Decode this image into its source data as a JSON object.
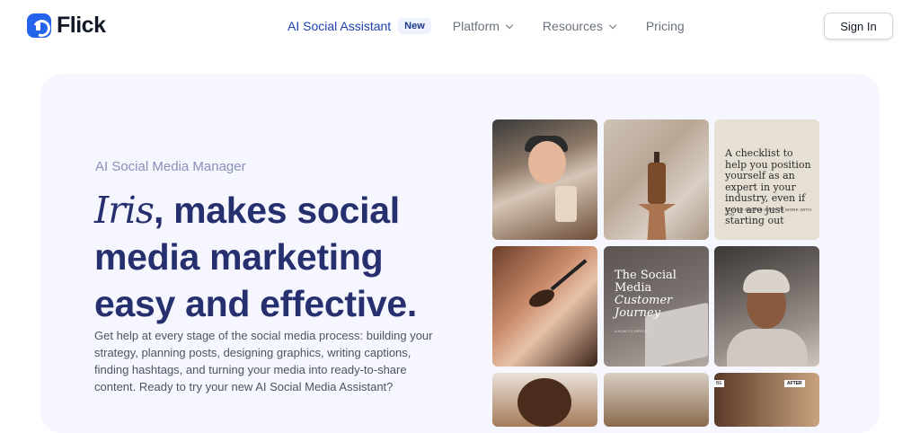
{
  "brand": {
    "name": "Flick",
    "color": "#2563eb"
  },
  "nav": {
    "items": [
      {
        "label": "AI Social Assistant",
        "badge": "New",
        "active": true
      },
      {
        "label": "Platform",
        "dropdown": true
      },
      {
        "label": "Resources",
        "dropdown": true
      },
      {
        "label": "Pricing"
      }
    ]
  },
  "header": {
    "signin_label": "Sign In"
  },
  "hero": {
    "eyebrow": "AI Social Media Manager",
    "headline_name": "Iris",
    "headline_rest": ", makes social media marketing easy and effective.",
    "description": "Get help at every stage of the social media process: building your strategy, planning posts, designing graphics, writing captions, finding hashtags, and turning your media into ready-to-share content. Ready to try your new AI Social Media Assistant?"
  },
  "gallery": {
    "tile3_text": "A checklist to help you position yourself as an expert in your industry, even if you are just starting out",
    "tile3_small": "SO THAT PEOPLE WANT TO WORK WITH YOU",
    "tile5_line1": "The Social Media",
    "tile5_line2": "Customer Journey",
    "tile5_small": "A HOW-TO IMPROVE",
    "tile9_label_a": "BE",
    "tile9_label_b": "AFTER"
  },
  "colors": {
    "headline": "#27306e",
    "eyebrow": "#8891b8",
    "hero_bg": "#f5f6fe",
    "nav_active": "#1e40af"
  }
}
